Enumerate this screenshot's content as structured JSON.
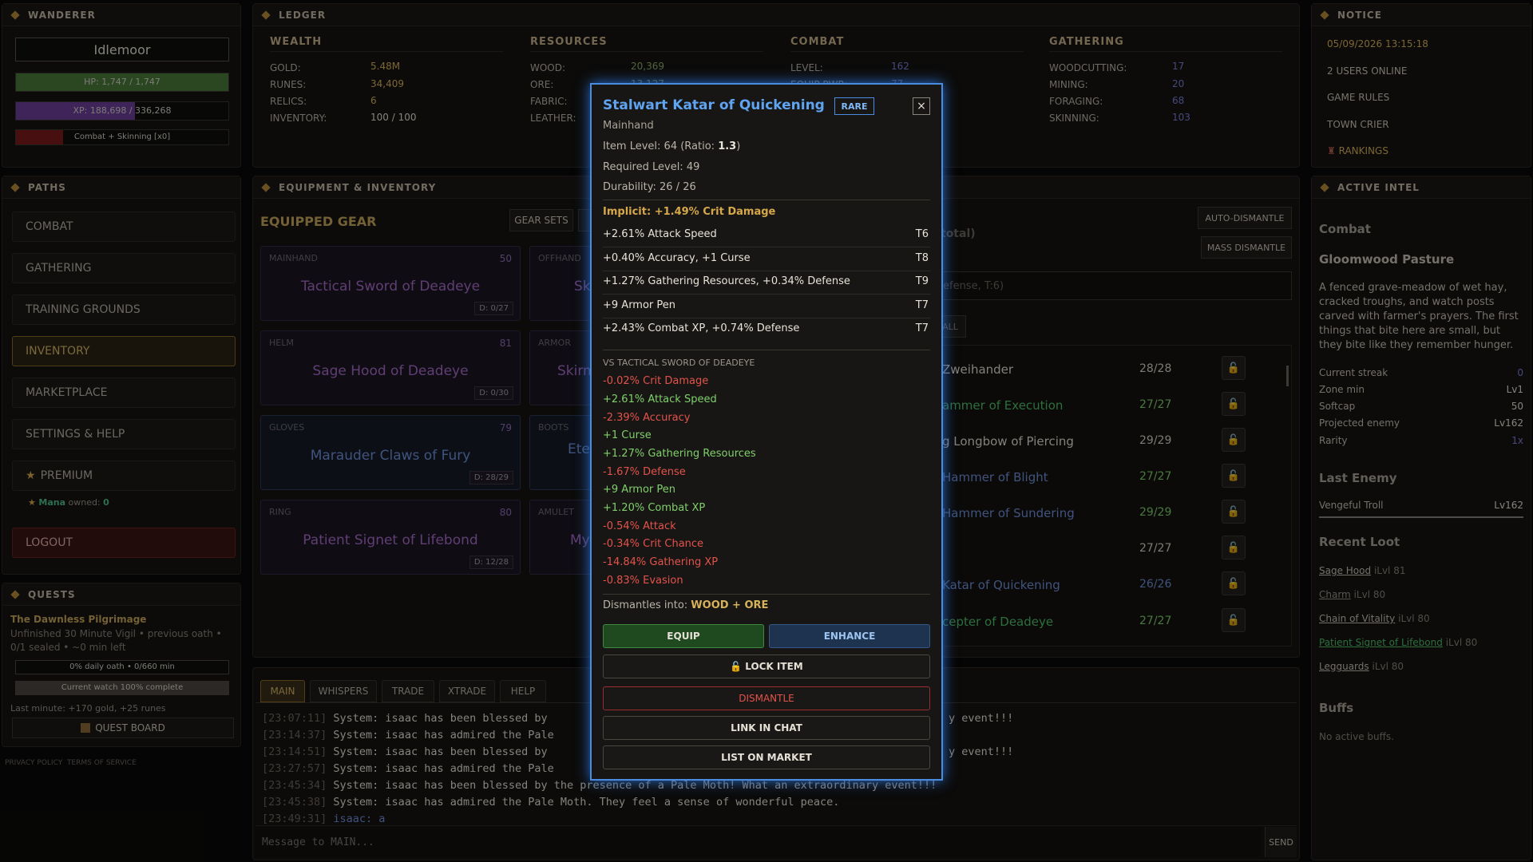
{
  "wanderer": {
    "header": "WANDERER",
    "name": "Idlemoor",
    "hp": "HP: 1,747 / 1,747",
    "hp_frac": 1.0,
    "xp": "XP: 188,698 / 336,268",
    "xp_frac": 0.56,
    "activity": "Combat + Skinning [x0]"
  },
  "ledger": {
    "header": "LEDGER",
    "wealth": {
      "title": "WEALTH",
      "rows": [
        [
          "GOLD:",
          "5.48M"
        ],
        [
          "RUNES:",
          "34,409"
        ],
        [
          "RELICS:",
          "6"
        ],
        [
          "INVENTORY:",
          "100 / 100"
        ]
      ]
    },
    "resources": {
      "title": "RESOURCES",
      "rows": [
        [
          "WOOD:",
          "20,369"
        ],
        [
          "ORE:",
          "13,127"
        ],
        [
          "FABRIC:",
          ""
        ],
        [
          "LEATHER:",
          ""
        ]
      ]
    },
    "combat": {
      "title": "COMBAT",
      "rows": [
        [
          "LEVEL:",
          "162"
        ],
        [
          "EQUIP PWR:",
          "77"
        ]
      ]
    },
    "gathering": {
      "title": "GATHERING",
      "rows": [
        [
          "WOODCUTTING:",
          "17"
        ],
        [
          "MINING:",
          "20"
        ],
        [
          "FORAGING:",
          "68"
        ],
        [
          "SKINNING:",
          "103"
        ]
      ]
    }
  },
  "notice": {
    "header": "NOTICE",
    "datetime": "05/09/2026 13:15:18",
    "online": "2 USERS ONLINE",
    "rules": "GAME RULES",
    "crier": "TOWN CRIER",
    "rankings": "RANKINGS"
  },
  "paths": {
    "header": "PATHS",
    "items": [
      "COMBAT",
      "GATHERING",
      "TRAINING GROUNDS",
      "INVENTORY",
      "MARKETPLACE",
      "SETTINGS & HELP"
    ],
    "premium": "PREMIUM",
    "mana_label": "Mana",
    "mana_owned": "owned:",
    "mana_count": "0",
    "logout": "LOGOUT"
  },
  "quests": {
    "header": "QUESTS",
    "title": "The Dawnless Pilgrimage",
    "desc1": "Unfinished 30 Minute Vigil • previous oath •",
    "desc2": "0/1 sealed • ~0 min left",
    "daily": "0% daily oath • 0/660 min",
    "watch": "Current watch 100% complete",
    "lastmin": "Last minute: +170 gold, +25 runes",
    "board": "QUEST BOARD"
  },
  "footer": {
    "privacy": "PRIVACY POLICY",
    "terms": "TERMS OF SERVICE"
  },
  "equip": {
    "header": "EQUIPMENT & INVENTORY",
    "title": "EQUIPPED GEAR",
    "gear_sets": "GEAR SETS",
    "auto_dismantle": "AUTO-DISMANTLE",
    "mass_dismantle": "MASS DISMANTLE",
    "inv_total": "total)",
    "filter_text": "efense, T:6)",
    "all_btn": "ALL",
    "gear": [
      {
        "slot": "MAINHAND",
        "ilvl": "50",
        "name": "Tactical Sword of Deadeye",
        "dur": "D: 0/27",
        "color": "#a56bc9"
      },
      {
        "slot": "OFFHAND",
        "ilvl": "",
        "name": "Sk",
        "dur": "",
        "color": "#a56bc9"
      },
      {
        "slot": "HELM",
        "ilvl": "81",
        "name": "Sage Hood of Deadeye",
        "dur": "D: 0/30",
        "color": "#a56bc9"
      },
      {
        "slot": "ARMOR",
        "ilvl": "",
        "name": "Skirm",
        "dur": "",
        "color": "#a56bc9"
      },
      {
        "slot": "GLOVES",
        "ilvl": "79",
        "name": "Marauder Claws of Fury",
        "dur": "D: 28/29",
        "color": "#6f8fd8"
      },
      {
        "slot": "BOOTS",
        "ilvl": "",
        "name": "Ete",
        "dur": "",
        "color": "#6f8fd8"
      },
      {
        "slot": "RING",
        "ilvl": "80",
        "name": "Patient Signet of Lifebond",
        "dur": "D: 12/28",
        "color": "#a56bc9"
      },
      {
        "slot": "AMULET",
        "ilvl": "",
        "name": "My",
        "dur": "",
        "color": "#a56bc9"
      }
    ],
    "inventory": [
      {
        "name": "Zweihander",
        "dur": "28/28",
        "color": "#e2ddd2"
      },
      {
        "name": "ammer of Execution",
        "dur": "27/27",
        "color": "#4fbf6a"
      },
      {
        "name": "g Longbow of Piercing",
        "dur": "29/29",
        "color": "#e2ddd2"
      },
      {
        "name": "Hammer of Blight",
        "dur": "27/27",
        "color": "#6f8fd8"
      },
      {
        "name": "Hammer of Sundering",
        "dur": "29/29",
        "color": "#6f8fd8"
      },
      {
        "name": "",
        "dur": "27/27",
        "color": "#e2ddd2"
      },
      {
        "name": "Katar of Quickening",
        "dur": "26/26",
        "color": "#6f8fd8"
      },
      {
        "name": "cepter of Deadeye",
        "dur": "27/27",
        "color": "#4fbf6a"
      }
    ]
  },
  "chat": {
    "tabs": [
      "MAIN",
      "WHISPERS",
      "TRADE",
      "XTRADE",
      "HELP"
    ],
    "lines": [
      {
        "ts": "[23:07:11]",
        "text": " System: isaac has been blessed by",
        "tail": "y event!!!"
      },
      {
        "ts": "[23:14:37]",
        "text": " System: isaac has admired the Pale",
        "tail": ""
      },
      {
        "ts": "[23:14:51]",
        "text": " System: isaac has been blessed by",
        "tail": "y event!!!"
      },
      {
        "ts": "[23:27:57]",
        "text": " System: isaac has admired the Pale",
        "tail": ""
      },
      {
        "ts": "[23:45:34]",
        "text": " System: isaac has been blessed by the presence of a Pale Moth! What an extraordinary event!!!",
        "tail": ""
      },
      {
        "ts": "[23:45:38]",
        "text": " System: isaac has admired the Pale Moth. They feel a sense of wonderful peace.",
        "tail": ""
      },
      {
        "ts": "[23:49:31]",
        "text": " isaac: a",
        "tail": ""
      }
    ],
    "placeholder": "Message to MAIN...",
    "send": "SEND"
  },
  "intel": {
    "header": "ACTIVE INTEL",
    "section": "Combat",
    "zone": "Gloomwood Pasture",
    "desc": "A fenced grave-meadow of wet hay, cracked troughs, and watch posts carved with farmer's prayers. The first things that bite here are small, but they bite like they remember hunger.",
    "rows": [
      [
        "Current streak",
        "0"
      ],
      [
        "Zone min",
        "Lv1"
      ],
      [
        "Softcap",
        "50"
      ],
      [
        "Projected enemy",
        "Lv162"
      ],
      [
        "Rarity",
        "1x"
      ]
    ],
    "last_enemy_title": "Last Enemy",
    "last_enemy": "Vengeful Troll",
    "last_enemy_lvl": "Lv162",
    "loot_title": "Recent Loot",
    "loot": [
      {
        "name": "Sage Hood",
        "lvl": "iLvl 81",
        "color": "#c9c3b8"
      },
      {
        "name": "Charm",
        "lvl": "iLvl 80",
        "color": "#9a958c"
      },
      {
        "name": "Chain of Vitality",
        "lvl": "iLvl 80",
        "color": "#c9c3b8"
      },
      {
        "name": "Patient Signet of Lifebond",
        "lvl": "iLvl 80",
        "color": "#4fbf6a"
      },
      {
        "name": "Legguards",
        "lvl": "iLvl 80",
        "color": "#c9c3b8"
      }
    ],
    "buffs_title": "Buffs",
    "buffs": "No active buffs."
  },
  "item": {
    "name": "Stalwart Katar of Quickening",
    "rarity": "RARE",
    "close": "×",
    "type": "Mainhand",
    "ilvl_text": "Item Level: 64 (Ratio: ",
    "ratio": "1.3",
    "ilvl_close": ")",
    "req": "Required Level: 49",
    "durability": "Durability: 26 / 26",
    "implicit": "Implicit: +1.49% Crit Damage",
    "stats": [
      [
        "+2.61% Attack Speed",
        "T6"
      ],
      [
        "+0.40% Accuracy, +1 Curse",
        "T8"
      ],
      [
        "+1.27% Gathering Resources, +0.34% Defense",
        "T9"
      ],
      [
        "+9 Armor Pen",
        "T7"
      ],
      [
        "+2.43% Combat XP, +0.74% Defense",
        "T7"
      ]
    ],
    "vs_title": "VS TACTICAL SWORD OF DEADEYE",
    "compare": [
      {
        "t": "-0.02% Crit Damage",
        "c": "#e2534b"
      },
      {
        "t": "+2.61% Attack Speed",
        "c": "#7fd06b"
      },
      {
        "t": "-2.39% Accuracy",
        "c": "#e2534b"
      },
      {
        "t": "+1 Curse",
        "c": "#7fd06b"
      },
      {
        "t": "+1.27% Gathering Resources",
        "c": "#7fd06b"
      },
      {
        "t": "-1.67% Defense",
        "c": "#e2534b"
      },
      {
        "t": "+9 Armor Pen",
        "c": "#7fd06b"
      },
      {
        "t": "+1.20% Combat XP",
        "c": "#7fd06b"
      },
      {
        "t": "-0.54% Attack",
        "c": "#e2534b"
      },
      {
        "t": "-0.34% Crit Chance",
        "c": "#e2534b"
      },
      {
        "t": "-14.84% Gathering XP",
        "c": "#e2534b"
      },
      {
        "t": "-0.83% Evasion",
        "c": "#e2534b"
      }
    ],
    "dismantle_label": "Dismantles into: ",
    "dismantle_val": "WOOD + ORE",
    "equip": "EQUIP",
    "enhance": "ENHANCE",
    "lock": "LOCK ITEM",
    "dismantle": "DISMANTLE",
    "link": "LINK IN CHAT",
    "market": "LIST ON MARKET"
  }
}
